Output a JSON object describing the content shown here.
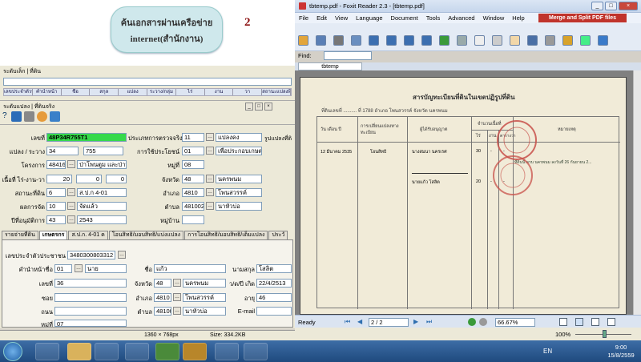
{
  "callout": {
    "line1": "ค้นเอกสารผ่านเครือข่าย",
    "line2": "internet(สำนักงาน)",
    "number": "2"
  },
  "app1": {
    "title": "ระดับเล็ก | ที่ดิน",
    "menu": [
      "เลขประจำตัวประชาชน",
      "คำนำหน้า",
      "ชื่อ",
      "สกุล",
      "แปลง",
      "ระวาง/กลุ่ม",
      "ไร่",
      "งาน",
      "วา",
      "สถานะแปลงที่ดิน"
    ]
  },
  "app2": {
    "title": "ระดับแปลง | ที่ดินจริง",
    "fields": {
      "doc_no_label": "เลขที่",
      "doc_no": "48P34R755T1",
      "plot_label": "แปลง / ระวาง",
      "plot_1": "34",
      "plot_2": "755",
      "project_label": "โครงการ",
      "project_code": "48416",
      "project_name": "ป่าโพนตูม และป่านาเ",
      "area_label": "เนื้อที่ ไร่-งาน-วา",
      "area_rai": "20",
      "area_ngan": "0",
      "area_wa": "0",
      "status_label": "สถานะที่ดิน",
      "status_code": "6",
      "status_text": "ส.ป.ก 4-01",
      "result_label": "ผลการจัด",
      "result_code": "10",
      "result_text": "จัดแล้ว",
      "year_label": "ปีที่อนุมัติการ",
      "year_code": "43",
      "year_text": "2543",
      "inspect_label": "ประเภทการตรวจจริง",
      "inspect_code": "11",
      "inspect_text": "แปลงคง",
      "use_label": "การใช้ประโยชน์",
      "use_code": "01",
      "use_text": "เพื่อประกอบเกษตรกรร",
      "village_label": "หมู่ที่",
      "village": "08",
      "province_label": "จังหวัด",
      "province_code": "48",
      "province_text": "นครพนม",
      "district_label": "อำเภอ",
      "district_code": "4810",
      "district_text": "โพนสวรรค์",
      "subdistrict_label": "ตำบล",
      "subdistrict_code": "481002",
      "subdistrict_text": "นาหัวบ่อ",
      "moo_label": "หมู่บ้าน",
      "attach_label": "รูปแปลงที่ดิ"
    },
    "tabs": [
      "รายจ่ายที่ดิน",
      "เกษตรกร",
      "ส.ป.ก. 4-01 ค",
      "โอนสิทธิ/มอบสิทธิ/แบ่งแปลง",
      "การโอนสิทธิ/มอบสิทธิ/เต็มแปลง",
      "ประวั"
    ],
    "farmer": {
      "id_label": "เลขประจำตัวประชาชน",
      "id": "3480300803312",
      "prefix_label": "คำนำหน้าชื่อ",
      "prefix_code": "01",
      "prefix_text": "นาย",
      "name_label": "ชื่อ",
      "name": "แก้ว",
      "surname_label": "นามสกุล",
      "surname": "โสลิต",
      "house_label": "เลขที่",
      "house": "36",
      "prov_label": "จังหวัด",
      "prov_code": "48",
      "prov_text": "นครพนม",
      "dob_label": "ว/ด/ปี เกิด",
      "dob": "22/4/2513",
      "soi_label": "ซอย",
      "dist_label": "อำเภอ",
      "dist_code": "4810",
      "dist_text": "โพนสวรรค์",
      "age_label": "อายุ",
      "age": "46",
      "road_label": "ถนน",
      "sub_label": "ตำบล",
      "sub_code": "48100",
      "sub_text": "นาหัวบ่อ",
      "email_label": "E-mail",
      "moo_label": "หมู่ที่",
      "moo": "07"
    }
  },
  "status_bar": {
    "dims": "1360 × 768px",
    "size": "Size: 334.2KB"
  },
  "foxit": {
    "title": "tbtemp.pdf - Foxit Reader 2.3 - [tbtemp.pdf]",
    "menu": [
      "File",
      "Edit",
      "View",
      "Language",
      "Document",
      "Tools",
      "Advanced",
      "Window",
      "Help"
    ],
    "merge_label": "Merge and Split PDF files",
    "find_label": "Find:",
    "doc_tab": "tbtemp",
    "page": "2 / 2",
    "zoom": "66.67%",
    "ready": "Ready"
  },
  "pdf": {
    "title": "สารบัญทะเบียนที่ดินในเขตปฏิรูปที่ดิน",
    "header_line": "ที่ดินเลขที่ ..........      ที่ 1788       อำเภอ โพนสวรรค์       จังหวัด นครพนม",
    "cols": [
      "วัน เดือน ปี",
      "การเปลี่ยนแปลงทางทะเบียน",
      "ผู้ได้รับอนุญาต",
      "ไร่",
      "งาน",
      "ตารางวา",
      "หมายเหตุ"
    ],
    "col_group": "จำนวนเนื้อที่",
    "row1": [
      "12 มีนาคม 2535",
      "โอนสิทธิ",
      "นางสมนา นครเรศ",
      "30",
      "-",
      "-"
    ],
    "row2": [
      "",
      "",
      "นายแก้ว โสลิต",
      "20",
      "-",
      "-"
    ],
    "stamp_text": "ที่ดินนี้ ครบ นครพนม ลงวันที่ 26 กันยายน 2..."
  },
  "taskbar": {
    "lang": "EN",
    "time": "9:00",
    "date": "15/8/2559",
    "zoom_pct": "100%"
  }
}
